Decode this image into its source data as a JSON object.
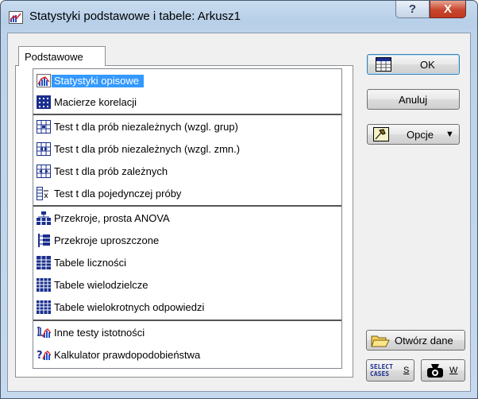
{
  "window": {
    "title": "Statystyki podstawowe i tabele: Arkusz1",
    "help_glyph": "?",
    "close_glyph": "X"
  },
  "tab": {
    "label": "Podstawowe"
  },
  "list": {
    "items": [
      {
        "label": "Statystyki opisowe",
        "icon": "descriptive-stats-icon",
        "selected": true
      },
      {
        "label": "Macierze korelacji",
        "icon": "correlation-matrix-icon"
      },
      {
        "label": "Test t dla prób niezależnych (wzgl. grup)",
        "icon": "t-test-groups-icon"
      },
      {
        "label": "Test t dla prób niezależnych (wzgl. zmn.)",
        "icon": "t-test-variables-icon"
      },
      {
        "label": "Test t dla prób zależnych",
        "icon": "t-test-dependent-icon"
      },
      {
        "label": "Test t dla pojedynczej próby",
        "icon": "t-test-single-icon"
      },
      {
        "label": "Przekroje, prosta ANOVA",
        "icon": "breakdown-anova-icon"
      },
      {
        "label": "Przekroje uproszczone",
        "icon": "breakdown-simple-icon"
      },
      {
        "label": "Tabele liczności",
        "icon": "frequency-table-icon"
      },
      {
        "label": "Tabele wielodzielcze",
        "icon": "crosstab-icon"
      },
      {
        "label": "Tabele wielokrotnych odpowiedzi",
        "icon": "multiple-response-icon"
      },
      {
        "label": "Inne testy istotności",
        "icon": "other-tests-icon"
      },
      {
        "label": "Kalkulator prawdopodobieństwa",
        "icon": "probability-calculator-icon"
      }
    ]
  },
  "buttons": {
    "ok": "OK",
    "cancel": "Anuluj",
    "options": "Opcje",
    "options_arrow": "▼",
    "open_data": "Otwórz dane",
    "select_cases_line1": "SELECT",
    "select_cases_line2": "CASES",
    "select_cases_key": "S",
    "weight_key": "W"
  },
  "colors": {
    "selection": "#3399ff",
    "title_bg": "#b9d1ea",
    "close_bg": "#c7432b"
  }
}
